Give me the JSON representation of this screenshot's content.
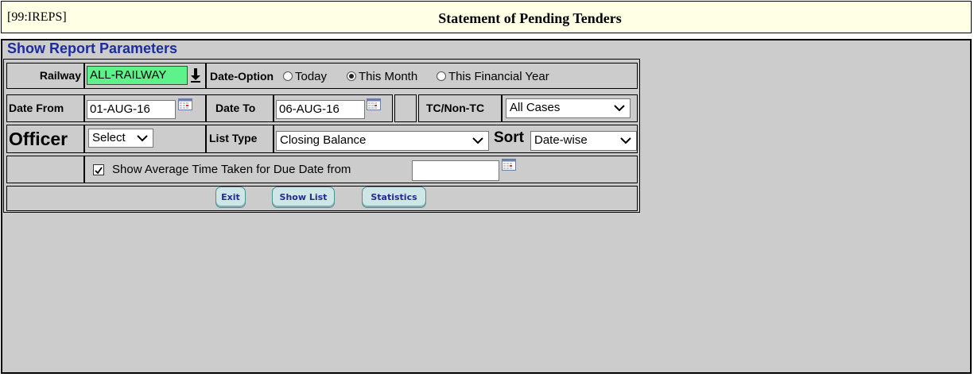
{
  "header": {
    "code": "[99:IREPS]",
    "title": "Statement of Pending Tenders"
  },
  "params": {
    "legend": "Show Report Parameters",
    "railway_label": "Railway",
    "railway_value": "ALL-RAILWAY",
    "date_option_label": "Date-Option",
    "date_options": [
      "Today",
      "This Month",
      "This Financial Year"
    ],
    "date_option_selected": "This Month",
    "date_from_label": "Date From",
    "date_from_value": "01-AUG-16",
    "date_to_label": "Date To",
    "date_to_value": "06-AUG-16",
    "tc_label": "TC/Non-TC",
    "tc_value": "All Cases",
    "officer_label": "Officer",
    "officer_value": "Select",
    "list_type_label": "List Type",
    "list_type_value": "Closing Balance",
    "sort_label": "Sort",
    "sort_value": "Date-wise",
    "avg_time_label": "Show Average Time Taken for Due Date from",
    "avg_time_checked": true,
    "avg_time_value": ""
  },
  "buttons": {
    "exit": "Exit",
    "show_list": "Show List",
    "statistics": "Statistics"
  },
  "colors": {
    "header_bg": "#ffffe6",
    "railway_bg": "#5ef28a",
    "legend": "#1c2ca0",
    "button_text": "#262a8c"
  }
}
